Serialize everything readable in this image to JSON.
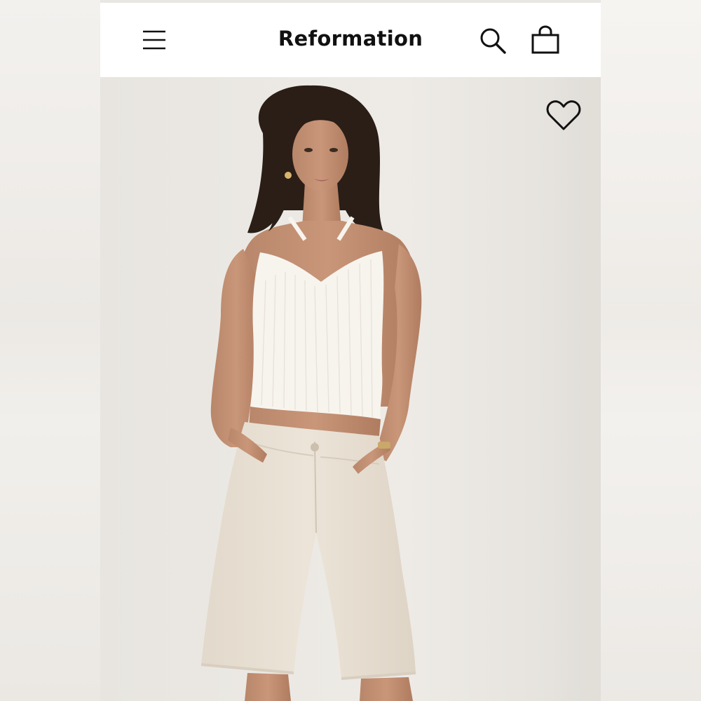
{
  "header": {
    "brand": "Reformation",
    "menu_icon": "hamburger-menu-icon",
    "search_icon": "search-icon",
    "bag_icon": "shopping-bag-icon"
  },
  "product_image": {
    "favorite_icon": "heart-icon",
    "description": ""
  },
  "colors": {
    "brand_text": "#111111",
    "header_bg": "#ffffff",
    "photo_bg": "#ebe8e3",
    "top": "#f7f4ee",
    "shorts": "#e6ddd0"
  }
}
